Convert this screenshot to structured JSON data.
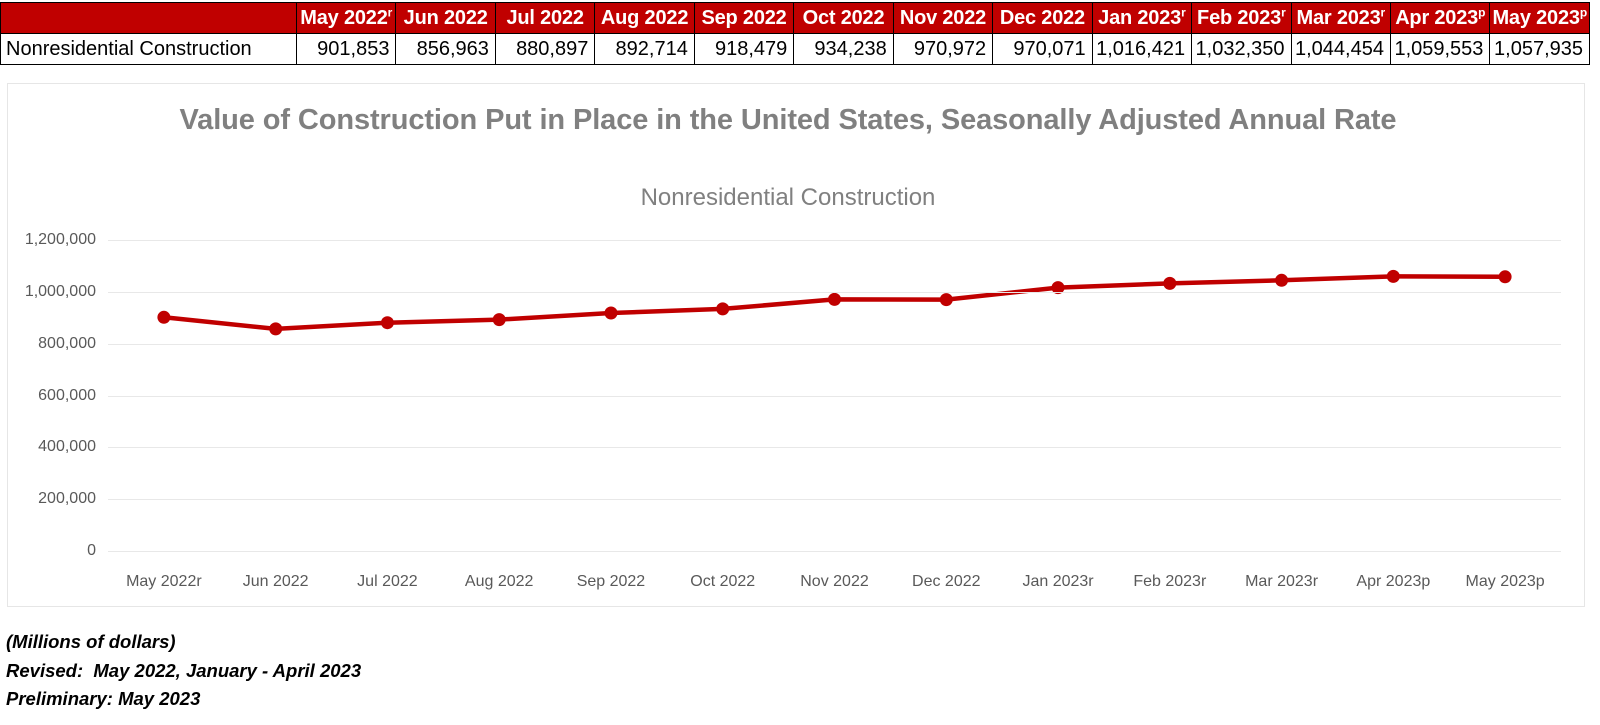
{
  "table": {
    "row_header_label": "",
    "columns": [
      {
        "label": "May 2022",
        "sup": "r"
      },
      {
        "label": "Jun 2022",
        "sup": ""
      },
      {
        "label": "Jul 2022",
        "sup": ""
      },
      {
        "label": "Aug 2022",
        "sup": ""
      },
      {
        "label": "Sep 2022",
        "sup": ""
      },
      {
        "label": "Oct 2022",
        "sup": ""
      },
      {
        "label": "Nov 2022",
        "sup": ""
      },
      {
        "label": "Dec 2022",
        "sup": ""
      },
      {
        "label": "Jan 2023",
        "sup": "r"
      },
      {
        "label": "Feb 2023",
        "sup": "r"
      },
      {
        "label": "Mar 2023",
        "sup": "r"
      },
      {
        "label": "Apr 2023",
        "sup": "p"
      },
      {
        "label": "May 2023",
        "sup": "p"
      }
    ],
    "rows": [
      {
        "label": "Nonresidential Construction",
        "values": [
          "901,853",
          "856,963",
          "880,897",
          "892,714",
          "918,479",
          "934,238",
          "970,972",
          "970,071",
          "1,016,421",
          "1,032,350",
          "1,044,454",
          "1,059,553",
          "1,057,935"
        ]
      }
    ],
    "header_color": "#C00000"
  },
  "chart_data": {
    "type": "line",
    "title": "Value of Construction Put in Place in the United States, Seasonally Adjusted Annual Rate",
    "subtitle": "Nonresidential Construction",
    "xlabel": "",
    "ylabel": "",
    "categories": [
      "May 2022r",
      "Jun 2022",
      "Jul 2022",
      "Aug 2022",
      "Sep 2022",
      "Oct 2022",
      "Nov 2022",
      "Dec 2022",
      "Jan 2023r",
      "Feb 2023r",
      "Mar 2023r",
      "Apr 2023p",
      "May 2023p"
    ],
    "series": [
      {
        "name": "Nonresidential Construction",
        "color": "#C00000",
        "values": [
          901853,
          856963,
          880897,
          892714,
          918479,
          934238,
          970972,
          970071,
          1016421,
          1032350,
          1044454,
          1059553,
          1057935
        ]
      }
    ],
    "ylim": [
      0,
      1200000
    ],
    "yticks": [
      1200000,
      1000000,
      800000,
      600000,
      400000,
      200000,
      0
    ],
    "ytick_labels": [
      "1,200,000",
      "1,000,000",
      "800,000",
      "600,000",
      "400,000",
      "200,000",
      "0"
    ],
    "grid": true,
    "legend": "none",
    "marker": "circle"
  },
  "footnotes": {
    "units": "(Millions of dollars)",
    "revised": "Revised:  May 2022, January - April 2023",
    "preliminary": "Preliminary: May 2023"
  }
}
